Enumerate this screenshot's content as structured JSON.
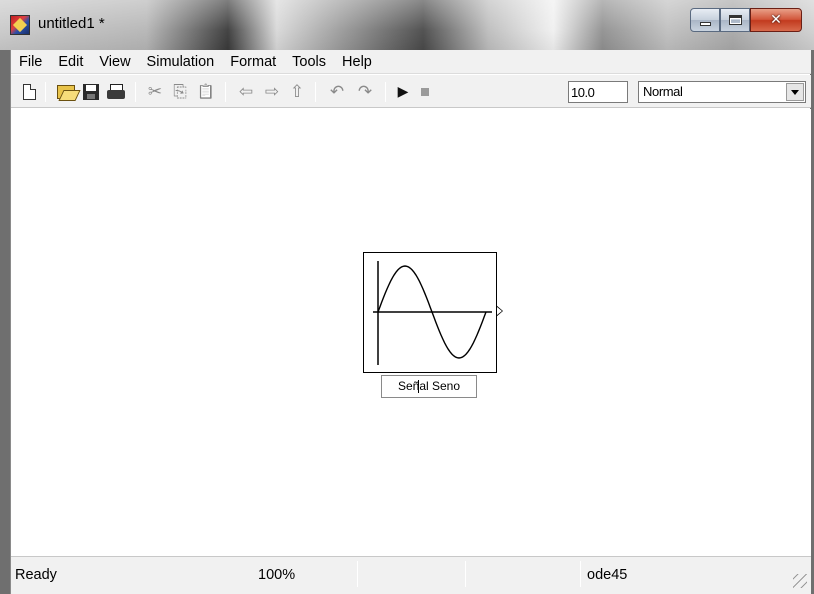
{
  "window": {
    "title": "untitled1 *",
    "close_glyph": "✕"
  },
  "menubar": {
    "items": [
      "File",
      "Edit",
      "View",
      "Simulation",
      "Format",
      "Tools",
      "Help"
    ]
  },
  "toolbar": {
    "buttons": [
      {
        "name": "new-model-icon"
      },
      {
        "name": "open-icon"
      },
      {
        "name": "save-icon"
      },
      {
        "name": "print-icon"
      },
      {
        "name": "cut-icon",
        "glyph": "✂"
      },
      {
        "name": "copy-icon",
        "glyph": "⎘"
      },
      {
        "name": "paste-icon",
        "glyph": "📋"
      },
      {
        "name": "back-icon",
        "glyph": "⇦"
      },
      {
        "name": "forward-icon",
        "glyph": "⇨"
      },
      {
        "name": "up-icon",
        "glyph": "⇧"
      },
      {
        "name": "undo-icon",
        "glyph": "↶"
      },
      {
        "name": "redo-icon",
        "glyph": "↷"
      },
      {
        "name": "start-simulation-icon",
        "glyph": "▶"
      },
      {
        "name": "stop-simulation-icon"
      }
    ],
    "stop_time": "10.0",
    "simulation_mode": "Normal"
  },
  "canvas": {
    "block": {
      "type": "sine-wave-source",
      "label_before_caret": "Señ",
      "label_after_caret": "al Seno"
    }
  },
  "statusbar": {
    "state": "Ready",
    "zoom": "100%",
    "solver": "ode45"
  },
  "colors": {
    "canvas_bg": "#ffffff",
    "chrome_bg": "#f1f1f1",
    "close_button": "#c94a2e"
  }
}
